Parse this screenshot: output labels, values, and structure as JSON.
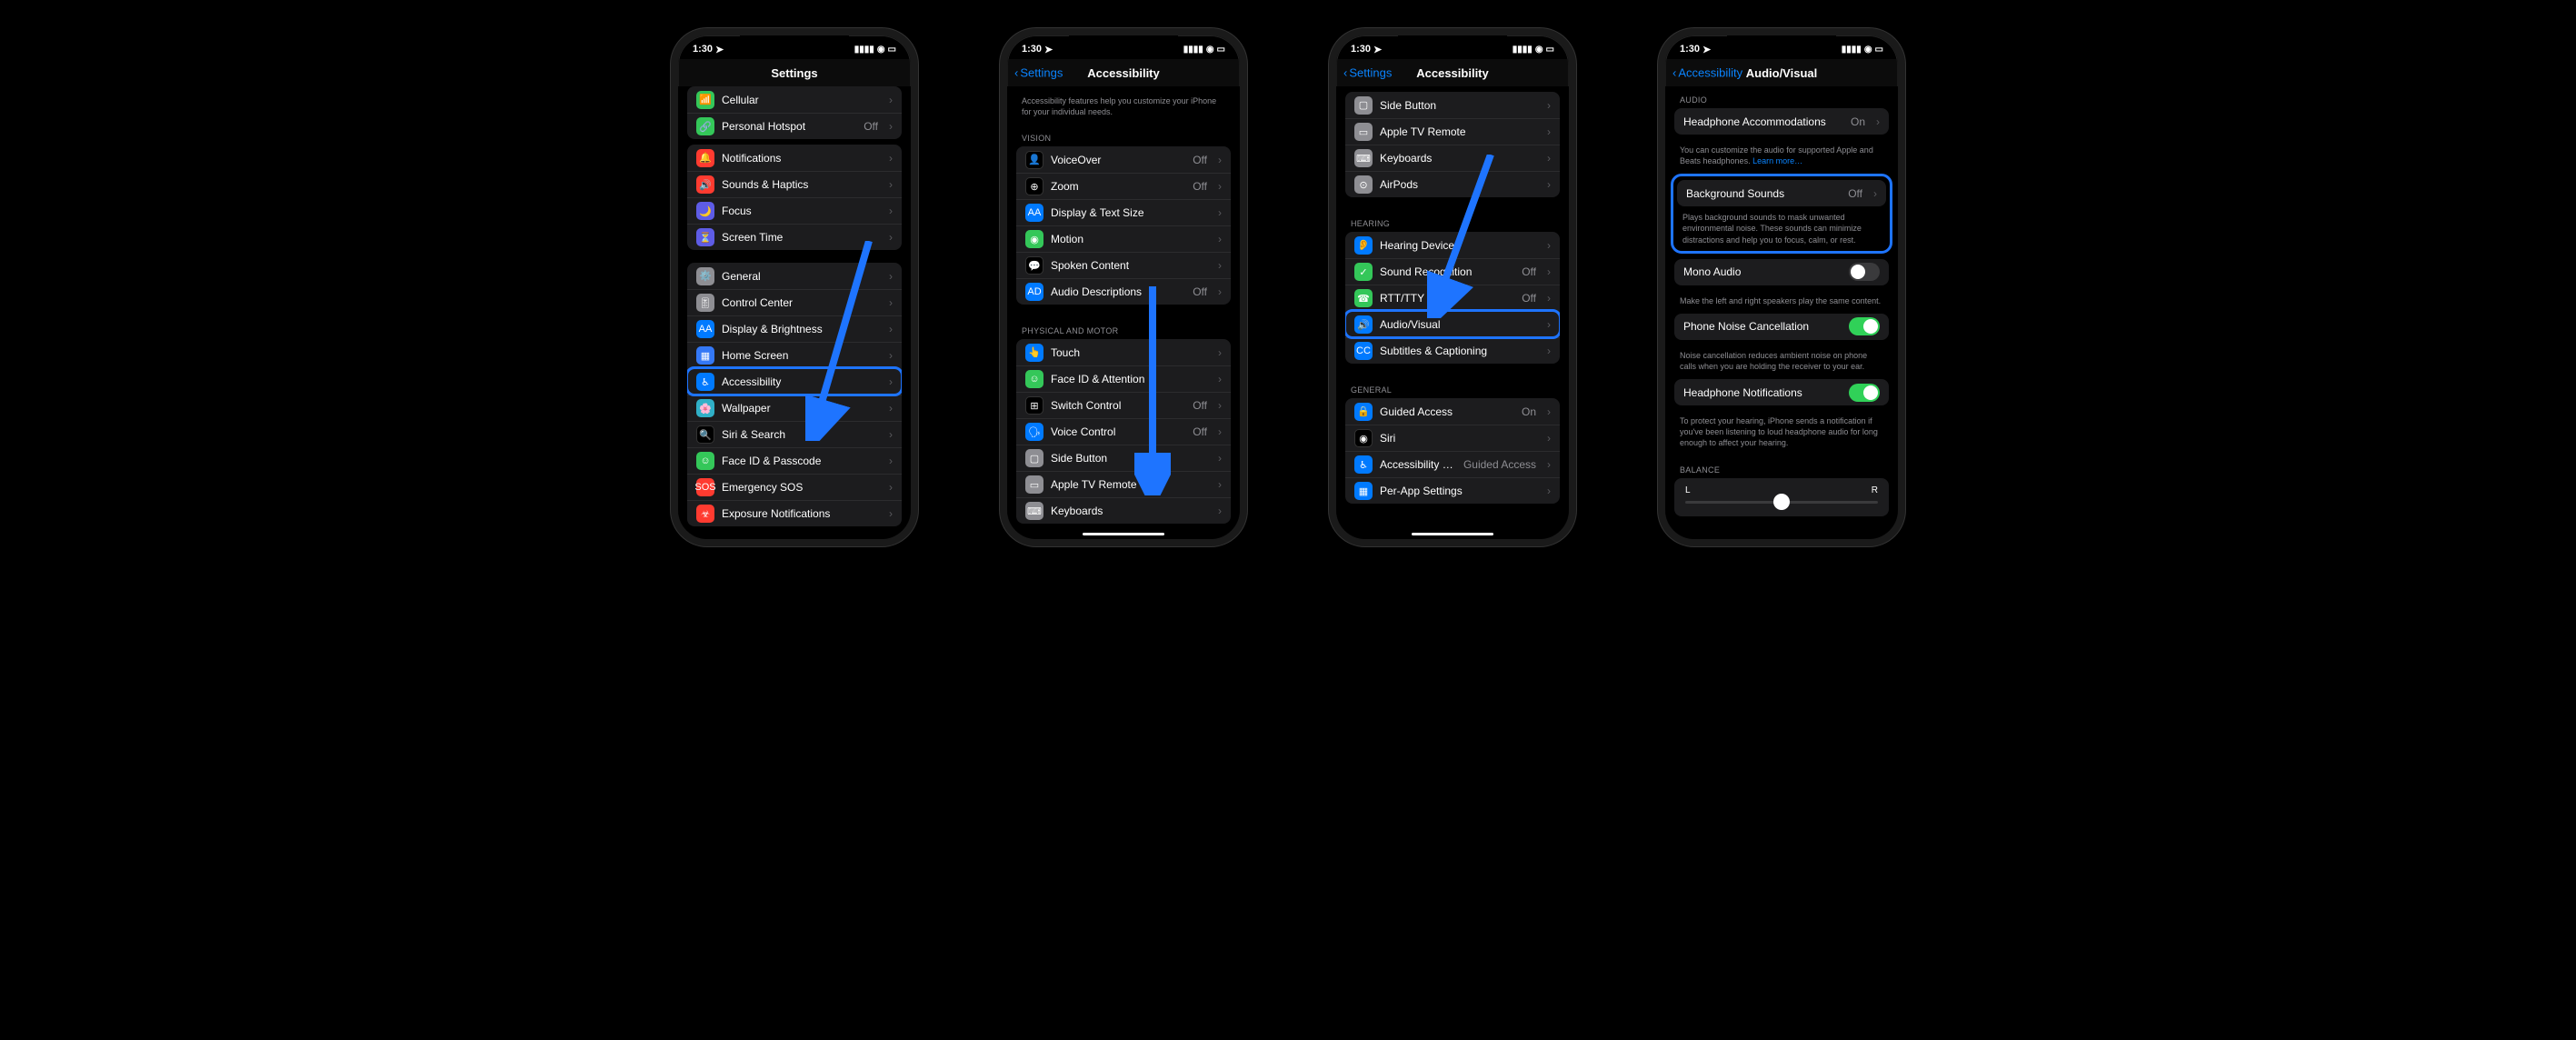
{
  "status": {
    "time": "1:30",
    "loc_icon": "➤"
  },
  "p1": {
    "title": "Settings",
    "g1": [
      {
        "icon": "📶",
        "bg": "bg-green",
        "label": "Cellular"
      },
      {
        "icon": "🔗",
        "bg": "bg-green",
        "label": "Personal Hotspot",
        "value": "Off"
      }
    ],
    "g2": [
      {
        "icon": "🔔",
        "bg": "bg-red",
        "label": "Notifications"
      },
      {
        "icon": "🔊",
        "bg": "bg-red",
        "label": "Sounds & Haptics"
      },
      {
        "icon": "🌙",
        "bg": "bg-indigo",
        "label": "Focus"
      },
      {
        "icon": "⏳",
        "bg": "bg-indigo",
        "label": "Screen Time"
      }
    ],
    "g3": [
      {
        "icon": "⚙️",
        "bg": "bg-gray",
        "label": "General"
      },
      {
        "icon": "🎚",
        "bg": "bg-gray",
        "label": "Control Center"
      },
      {
        "icon": "AA",
        "bg": "bg-blue",
        "label": "Display & Brightness"
      },
      {
        "icon": "▦",
        "bg": "bg-darkblue",
        "label": "Home Screen"
      },
      {
        "icon": "♿︎",
        "bg": "bg-blue",
        "label": "Accessibility",
        "hl": true
      },
      {
        "icon": "🌸",
        "bg": "bg-teal",
        "label": "Wallpaper"
      },
      {
        "icon": "🔍",
        "bg": "bg-black",
        "label": "Siri & Search"
      },
      {
        "icon": "☺",
        "bg": "bg-green",
        "label": "Face ID & Passcode"
      },
      {
        "icon": "SOS",
        "bg": "bg-red",
        "label": "Emergency SOS"
      },
      {
        "icon": "☣",
        "bg": "bg-red",
        "label": "Exposure Notifications"
      }
    ]
  },
  "p2": {
    "back": "Settings",
    "title": "Accessibility",
    "desc": "Accessibility features help you customize your iPhone for your individual needs.",
    "sec1": "Vision",
    "g1": [
      {
        "icon": "👤",
        "bg": "bg-black",
        "label": "VoiceOver",
        "value": "Off"
      },
      {
        "icon": "⊕",
        "bg": "bg-black",
        "label": "Zoom",
        "value": "Off"
      },
      {
        "icon": "AA",
        "bg": "bg-blue",
        "label": "Display & Text Size"
      },
      {
        "icon": "◉",
        "bg": "bg-green",
        "label": "Motion"
      },
      {
        "icon": "💬",
        "bg": "bg-black",
        "label": "Spoken Content"
      },
      {
        "icon": "AD",
        "bg": "bg-blue",
        "label": "Audio Descriptions",
        "value": "Off"
      }
    ],
    "sec2": "Physical and Motor",
    "g2": [
      {
        "icon": "👆",
        "bg": "bg-blue",
        "label": "Touch"
      },
      {
        "icon": "☺",
        "bg": "bg-green",
        "label": "Face ID & Attention"
      },
      {
        "icon": "⊞",
        "bg": "bg-black",
        "label": "Switch Control",
        "value": "Off"
      },
      {
        "icon": "🗣",
        "bg": "bg-blue",
        "label": "Voice Control",
        "value": "Off"
      },
      {
        "icon": "▢",
        "bg": "bg-gray",
        "label": "Side Button"
      },
      {
        "icon": "▭",
        "bg": "bg-gray",
        "label": "Apple TV Remote"
      },
      {
        "icon": "⌨",
        "bg": "bg-gray",
        "label": "Keyboards"
      }
    ]
  },
  "p3": {
    "back": "Settings",
    "title": "Accessibility",
    "g1": [
      {
        "icon": "▢",
        "bg": "bg-gray",
        "label": "Side Button"
      },
      {
        "icon": "▭",
        "bg": "bg-gray",
        "label": "Apple TV Remote"
      },
      {
        "icon": "⌨",
        "bg": "bg-gray",
        "label": "Keyboards"
      },
      {
        "icon": "⊙",
        "bg": "bg-gray",
        "label": "AirPods"
      }
    ],
    "sec2": "Hearing",
    "g2": [
      {
        "icon": "👂",
        "bg": "bg-blue",
        "label": "Hearing Devices"
      },
      {
        "icon": "✓",
        "bg": "bg-green",
        "label": "Sound Recognition",
        "value": "Off"
      },
      {
        "icon": "☎",
        "bg": "bg-green",
        "label": "RTT/TTY",
        "value": "Off"
      },
      {
        "icon": "🔊",
        "bg": "bg-blue",
        "label": "Audio/Visual",
        "hl": true
      },
      {
        "icon": "CC",
        "bg": "bg-blue",
        "label": "Subtitles & Captioning"
      }
    ],
    "sec3": "General",
    "g3": [
      {
        "icon": "🔒",
        "bg": "bg-blue",
        "label": "Guided Access",
        "value": "On"
      },
      {
        "icon": "◉",
        "bg": "bg-black",
        "label": "Siri"
      },
      {
        "icon": "♿︎",
        "bg": "bg-blue",
        "label": "Accessibility Shortcut",
        "value": "Guided Access"
      },
      {
        "icon": "▦",
        "bg": "bg-blue",
        "label": "Per-App Settings"
      }
    ]
  },
  "p4": {
    "back": "Accessibility",
    "title": "Audio/Visual",
    "sec1": "Audio",
    "r1": {
      "label": "Headphone Accommodations",
      "value": "On"
    },
    "f1a": "You can customize the audio for supported Apple and Beats headphones. ",
    "f1b": "Learn more…",
    "r2": {
      "label": "Background Sounds",
      "value": "Off"
    },
    "f2": "Plays background sounds to mask unwanted environmental noise. These sounds can minimize distractions and help you to focus, calm, or rest.",
    "r3": {
      "label": "Mono Audio"
    },
    "f3": "Make the left and right speakers play the same content.",
    "r4": {
      "label": "Phone Noise Cancellation"
    },
    "f4": "Noise cancellation reduces ambient noise on phone calls when you are holding the receiver to your ear.",
    "r5": {
      "label": "Headphone Notifications"
    },
    "f5": "To protect your hearing, iPhone sends a notification if you've been listening to loud headphone audio for long enough to affect your hearing.",
    "sec2": "Balance",
    "bal": {
      "left": "L",
      "right": "R"
    }
  }
}
